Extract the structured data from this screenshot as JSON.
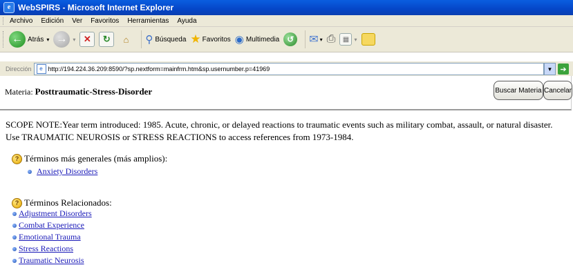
{
  "window": {
    "title": "WebSPIRS - Microsoft Internet Explorer"
  },
  "menu": [
    "Archivo",
    "Edición",
    "Ver",
    "Favoritos",
    "Herramientas",
    "Ayuda"
  ],
  "toolbar": {
    "back": "Atrás",
    "search": "Búsqueda",
    "favorites": "Favoritos",
    "media": "Multimedia"
  },
  "address": {
    "label": "Dirección",
    "url": "http://194.224.36.209:8590/?sp.nextform=mainfrm.htm&sp.usernumber.p=41969"
  },
  "header": {
    "materia_label": "Materia:",
    "materia_value": "Posttraumatic-Stress-Disorder",
    "buscar_button": "Buscar Materia",
    "cancelar_button": "Cancelar"
  },
  "scope_note": "SCOPE NOTE:Year term introduced: 1985. Acute, chronic, or delayed reactions to traumatic events such as military combat, assault, or natural disaster. Use TRAUMATIC NEUROSIS or STRESS REACTIONS to access references from 1973-1984.",
  "broader": {
    "heading": "Términos más generales (más amplios):",
    "items": [
      "Anxiety Disorders"
    ]
  },
  "related": {
    "heading": "Términos Relacionados:",
    "items": [
      "Adjustment Disorders",
      "Combat Experience",
      "Emotional Trauma",
      "Stress Reactions",
      "Traumatic Neurosis"
    ]
  },
  "colors": {
    "titlebar": "#0546c8",
    "link": "#1a1ab8",
    "chrome": "#ece9d8"
  }
}
